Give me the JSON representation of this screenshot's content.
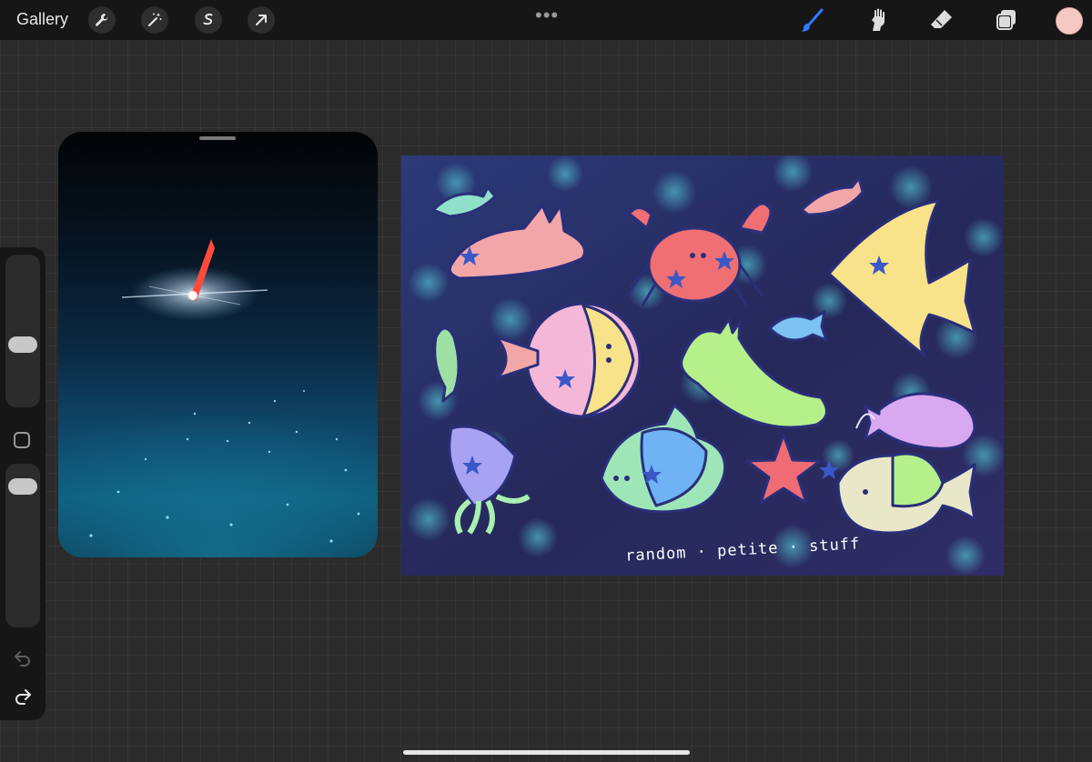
{
  "toolbar": {
    "gallery_label": "Gallery",
    "left_tools": [
      "wrench-icon",
      "magic-wand-icon",
      "selection-icon",
      "transform-arrow-icon"
    ],
    "more_dots": "•••",
    "right_tools": [
      "brush-icon",
      "smudge-icon",
      "eraser-icon",
      "layers-icon"
    ],
    "active_tool": "brush-icon",
    "accent_color": "#2f7bff",
    "current_color": "#f6c8c4"
  },
  "artwork": {
    "watermark": "random · petite · stuff"
  },
  "sidebar": {
    "controls": [
      "brush-size-slider",
      "modify-button",
      "brush-opacity-slider",
      "undo-button",
      "redo-button"
    ]
  }
}
